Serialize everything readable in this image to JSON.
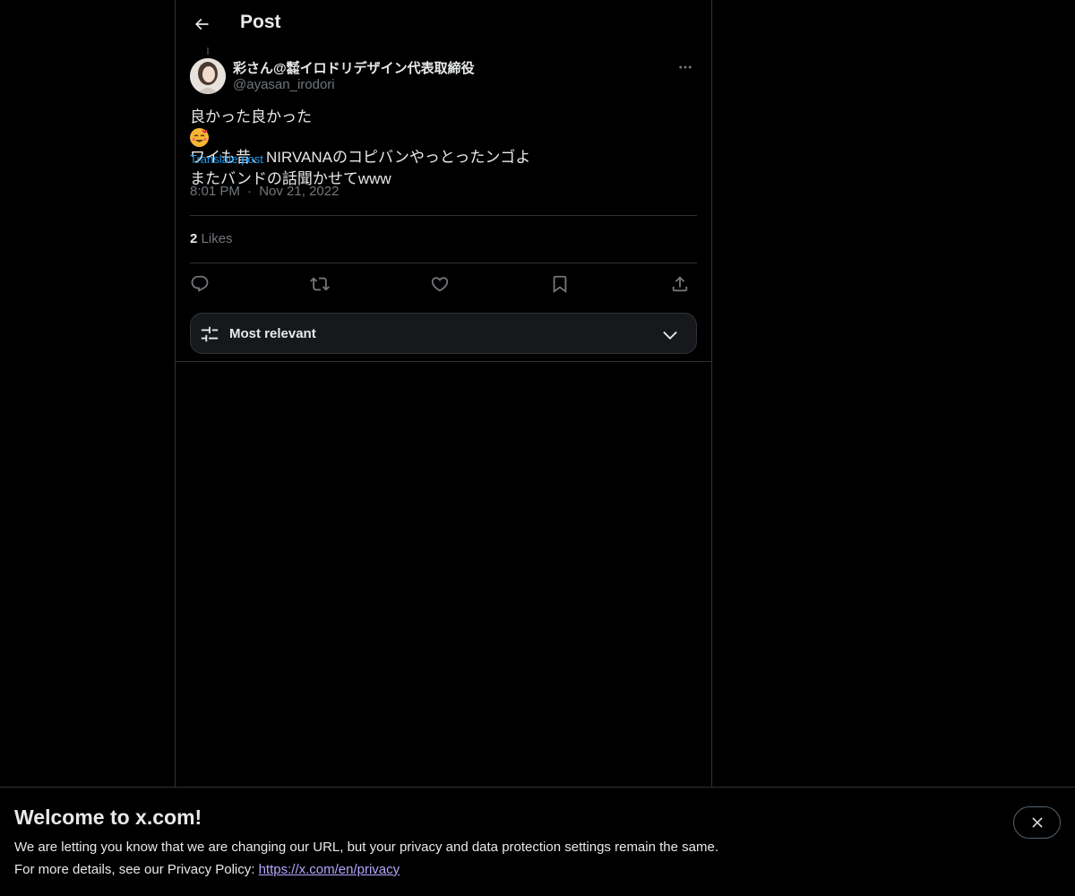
{
  "header": {
    "title": "Post"
  },
  "author": {
    "name": "彩さん@㍿イロドリデザイン代表取締役",
    "handle": "@ayasan_irodori"
  },
  "post": {
    "line1_a": "良かった良かった",
    "line1_b": "ワイも昔、NIRVANAのコピバンやっとったンゴよ",
    "line2": "またバンドの話聞かせてwww",
    "translate_label": "Translate post",
    "time": "8:01 PM",
    "separator": "·",
    "date": "Nov 21, 2022"
  },
  "stats": {
    "likes_count": "2",
    "likes_label": "Likes"
  },
  "sort": {
    "label": "Most relevant"
  },
  "banner": {
    "title": "Welcome to x.com!",
    "line1": "We are letting you know that we are changing our URL, but your privacy and data protection settings remain the same.",
    "line2_prefix": "For more details, see our Privacy Policy: ",
    "link": "https://x.com/en/privacy"
  },
  "icons": {
    "back": "arrow-left-icon",
    "more": "more-horizontal-icon",
    "reply": "reply-icon",
    "repost": "repost-icon",
    "like": "heart-icon",
    "bookmark": "bookmark-icon",
    "share": "share-icon",
    "sort": "sliders-icon",
    "chevron": "chevron-down-icon",
    "close": "close-icon",
    "emoji": "smiling-face-with-hearts-emoji"
  },
  "colors": {
    "background": "#000000",
    "text": "#e7e9ea",
    "muted": "#71767b",
    "link": "#1d9bf0",
    "border": "#2f3336"
  }
}
